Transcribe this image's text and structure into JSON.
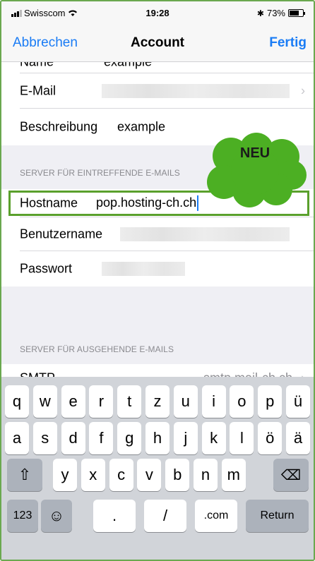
{
  "status_bar": {
    "carrier": "Swisscom",
    "time": "19:28",
    "battery": "73%",
    "battery_level": 0.73
  },
  "nav": {
    "cancel": "Abbrechen",
    "title": "Account",
    "done": "Fertig"
  },
  "account": {
    "name_label": "Name",
    "name_value": "example",
    "email_label": "E-Mail",
    "description_label": "Beschreibung",
    "description_value": "example"
  },
  "incoming": {
    "header": "SERVER FÜR EINTREFFENDE E-MAILS",
    "hostname_label": "Hostname",
    "hostname_value": "pop.hosting-ch.ch",
    "username_label": "Benutzername",
    "password_label": "Passwort"
  },
  "outgoing": {
    "header": "SERVER FÜR AUSGEHENDE E-MAILS",
    "smtp_label": "SMTP",
    "smtp_value": "smtp.mail-ch.ch"
  },
  "callout": {
    "label": "NEU",
    "color": "#4caf23",
    "highlight_color": "#5aa02c"
  },
  "keyboard": {
    "row1": [
      "q",
      "w",
      "e",
      "r",
      "t",
      "z",
      "u",
      "i",
      "o",
      "p",
      "ü"
    ],
    "row2": [
      "a",
      "s",
      "d",
      "f",
      "g",
      "h",
      "j",
      "k",
      "l",
      "ö",
      "ä"
    ],
    "row3": [
      "y",
      "x",
      "c",
      "v",
      "b",
      "n",
      "m"
    ],
    "numbers_key": "123",
    "period_key": ".",
    "slash_key": "/",
    "dotcom_key": ".com",
    "return_key": "Return",
    "shift_icon": "shift-icon",
    "delete_icon": "delete-icon",
    "emoji_icon": "emoji-icon"
  }
}
